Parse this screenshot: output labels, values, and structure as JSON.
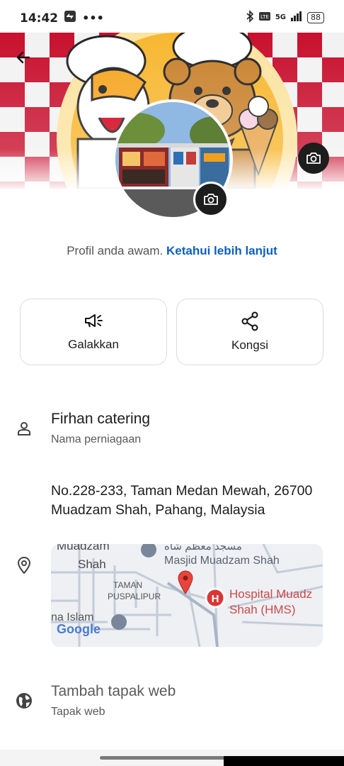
{
  "status_bar": {
    "time": "14:42",
    "network": "5G",
    "battery": "88"
  },
  "cover": {
    "back_icon": "arrow-left-icon",
    "camera_icon": "camera-icon"
  },
  "profile": {
    "camera_icon": "camera-icon"
  },
  "public_note": {
    "text": "Profil anda awam.",
    "link": "Ketahui lebih lanjut"
  },
  "actions": [
    {
      "label": "Galakkan",
      "icon": "megaphone-icon"
    },
    {
      "label": "Kongsi",
      "icon": "share-icon"
    }
  ],
  "business": {
    "name": "Firhan catering",
    "name_caption": "Nama perniagaan",
    "address": "No.228-233, Taman Medan Mewah, 26700 Muadzam Shah, Pahang, Malaysia",
    "website": "Tambah tapak web",
    "website_caption": "Tapak web"
  },
  "map": {
    "label_town": "Muadzam Shah",
    "label_town_top": "Muadzam",
    "label_mosque": "Masjid Muadzam Shah",
    "label_arabic": "مسجد معظم شاه",
    "label_taman": "TAMAN",
    "label_puspalipur": "PUSPALIPUR",
    "label_hospital_1": "Hospital Muadz",
    "label_hospital_2": "Shah (HMS)",
    "label_islam": "na Islam",
    "label_google": "Google",
    "hospital_marker": "H",
    "marker_color": "#e8453c"
  },
  "colors": {
    "link": "#0a5fc4",
    "checker_red": "#c8102e"
  }
}
